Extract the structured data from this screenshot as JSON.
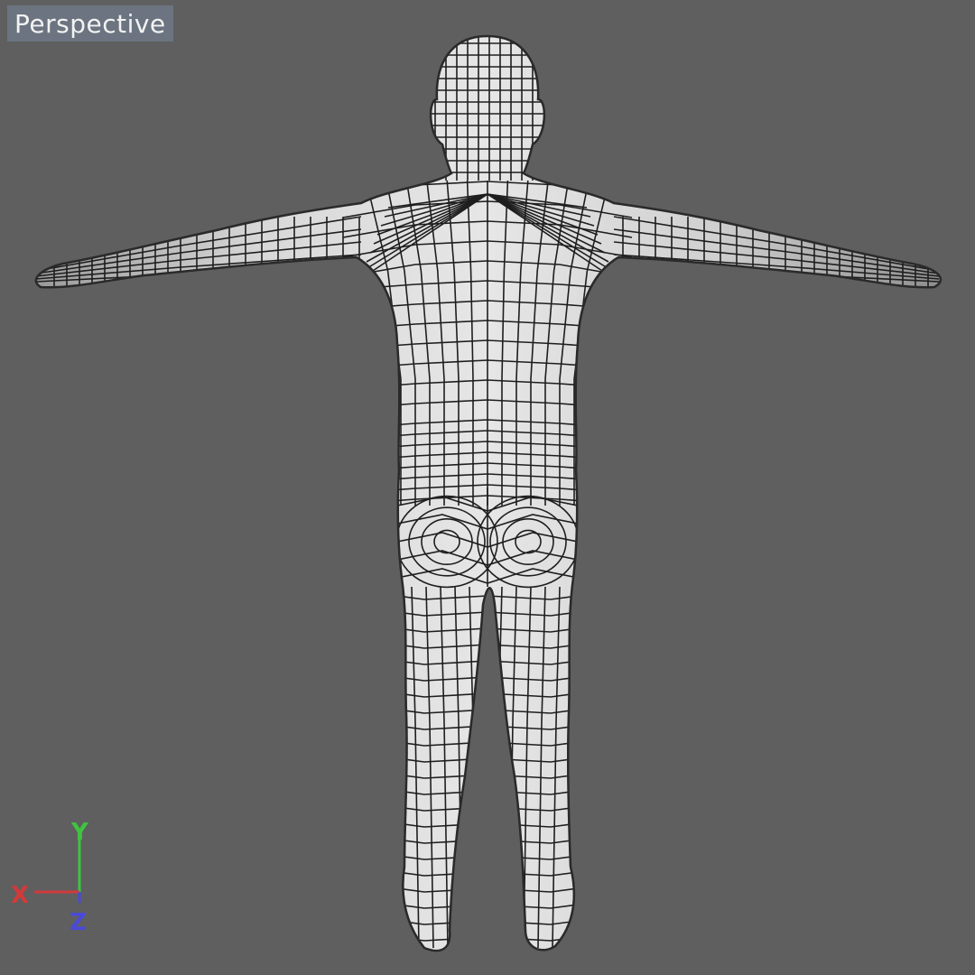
{
  "viewport": {
    "view_name": "Perspective",
    "background_color": "#5f5f5f"
  },
  "model": {
    "type": "human body wireframe mesh",
    "view": "back",
    "pose": "T-pose",
    "mesh_color": "#d9d9d9",
    "wire_color": "#1e1e1e"
  },
  "axis_gizmo": {
    "x_label": "X",
    "y_label": "Y",
    "z_label": "Z",
    "x_color": "#d23a3a",
    "y_color": "#3fc43f",
    "z_color": "#4a4ad8"
  }
}
